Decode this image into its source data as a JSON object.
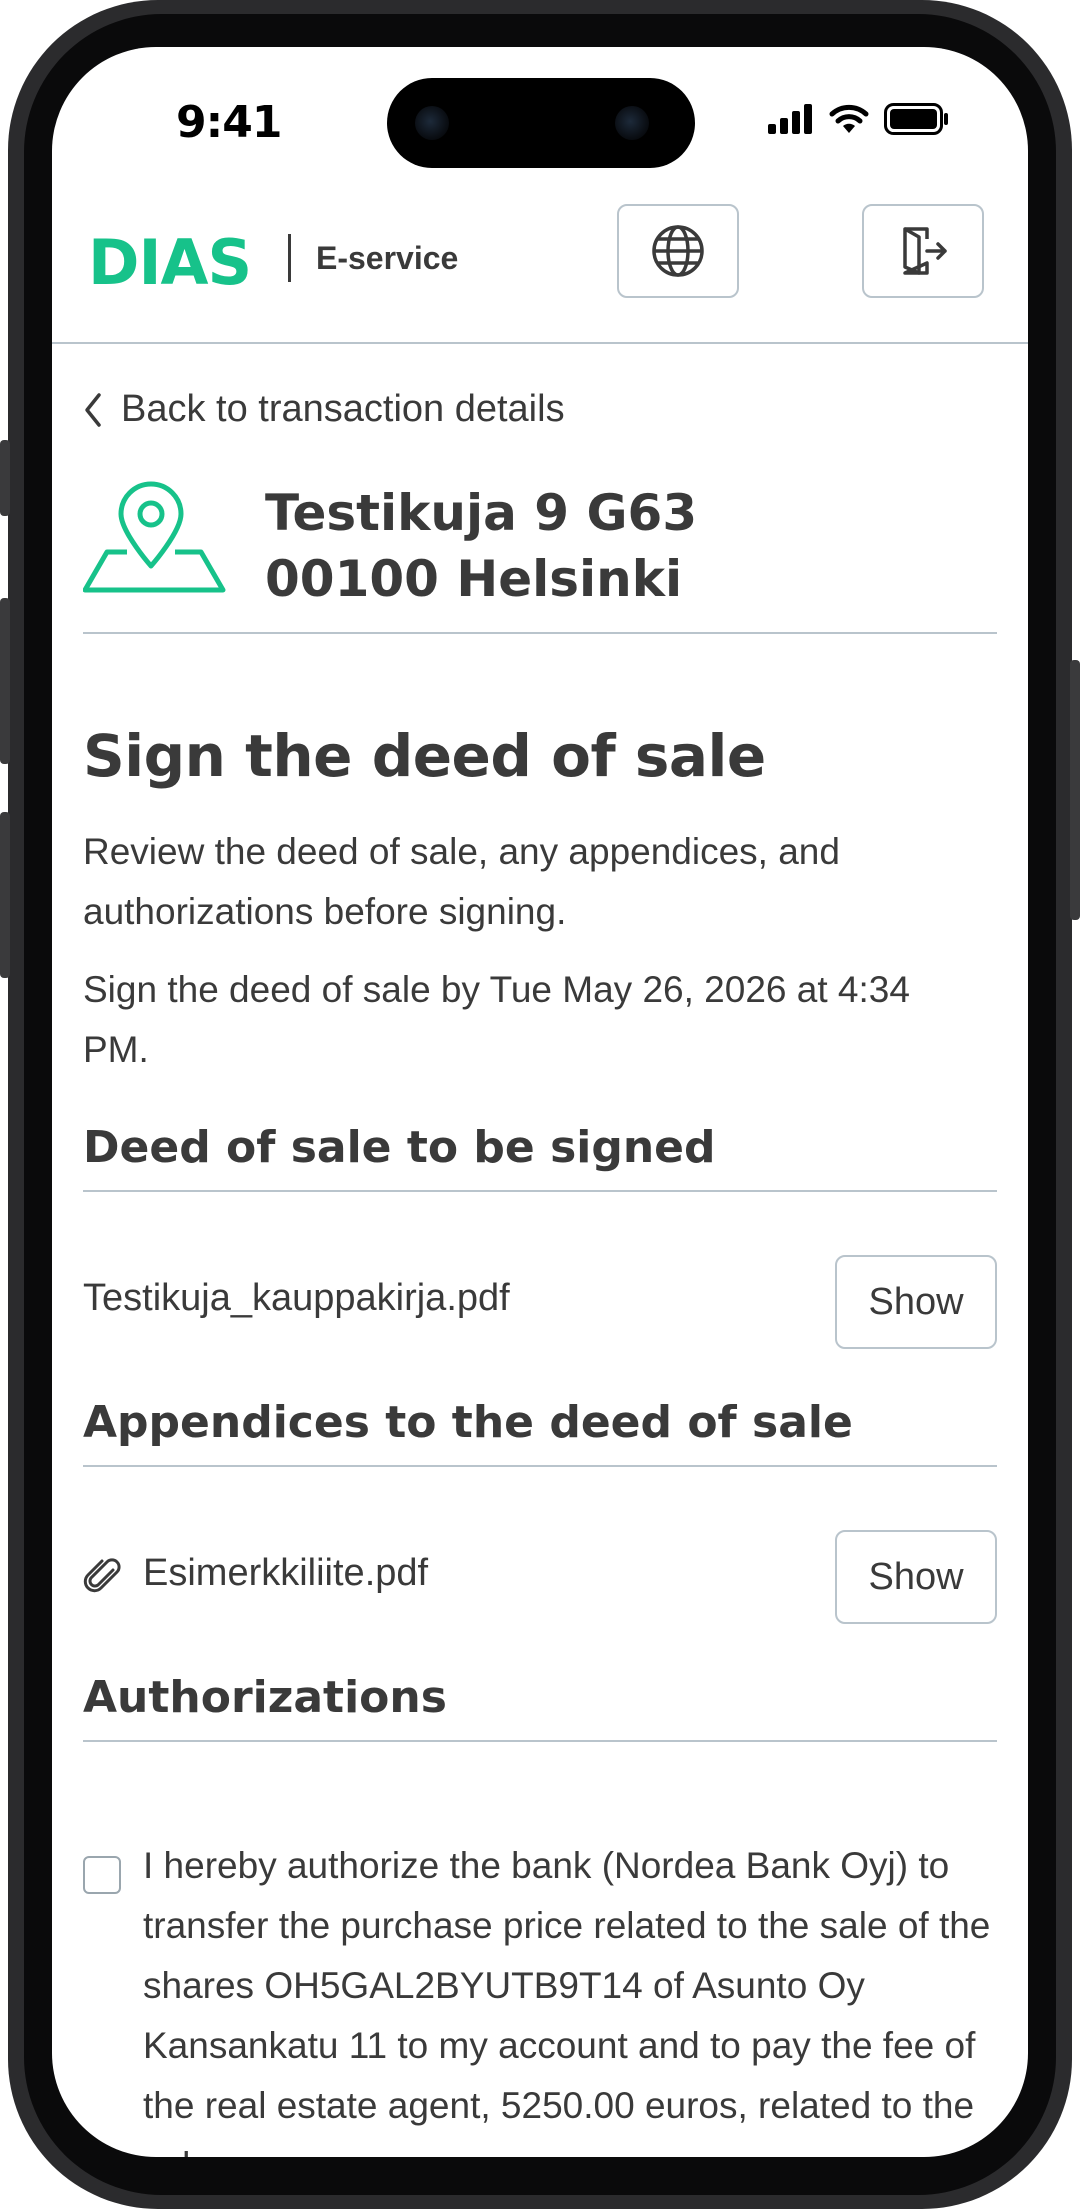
{
  "status_bar": {
    "time": "9:41"
  },
  "header": {
    "logo": "DIAS",
    "subtitle": "E-service",
    "language_icon": "globe-icon",
    "logout_icon": "logout-icon"
  },
  "navigation": {
    "back_label": "Back to transaction details"
  },
  "property": {
    "address_line1": "Testikuja 9 G63",
    "address_line2": "00100 Helsinki",
    "icon": "map-pin-icon"
  },
  "page": {
    "title": "Sign the deed of sale",
    "intro": "Review the deed of sale, any appendices, and authorizations before signing.",
    "deadline": "Sign the deed of sale by Tue May 26, 2026 at 4:34 PM."
  },
  "deed_section": {
    "heading": "Deed of sale to be signed",
    "file_name": "Testikuja_kauppakirja.pdf",
    "show_label": "Show"
  },
  "appendices_section": {
    "heading": "Appendices to the deed of sale",
    "file_name": "Esimerkkiliite.pdf",
    "show_label": "Show",
    "file_icon": "paperclip-icon"
  },
  "authorizations_section": {
    "heading": "Authorizations",
    "items": [
      {
        "checked": false,
        "text": "I hereby authorize the bank (Nordea Bank Oyj) to transfer the purchase price related to the sale of the shares OH5GAL2BYUTB9T14 of Asunto Oy Kansankatu 11 to my account and to pay the fee of the real estate agent, 5250.00 euros, related to the sale."
      }
    ]
  },
  "colors": {
    "brand": "#17c28a",
    "text": "#3a3a3a",
    "border": "#b9c4cc"
  }
}
